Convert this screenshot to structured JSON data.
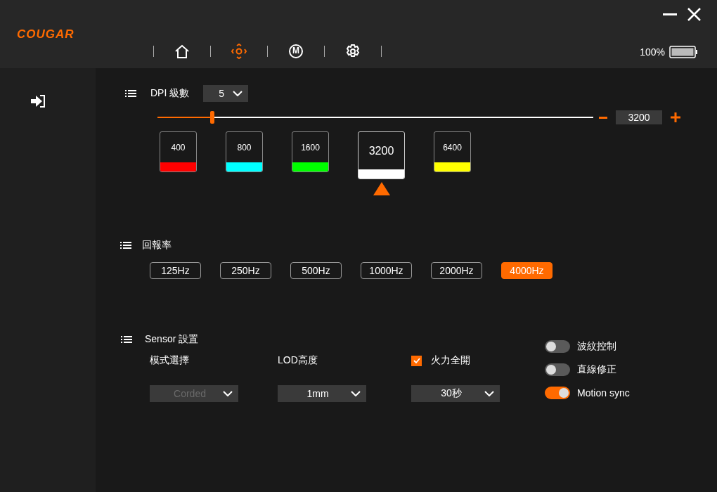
{
  "header": {
    "logo": "COUGAR",
    "nav": [
      {
        "kind": "home",
        "selected": false
      },
      {
        "kind": "dpi",
        "selected": true
      },
      {
        "kind": "macro",
        "label": "M",
        "selected": false
      },
      {
        "kind": "settings",
        "selected": false
      }
    ],
    "battery": "100%"
  },
  "dpi": {
    "title": "DPI 級數",
    "stage_count": "5",
    "level": 0.125,
    "value": "3200",
    "stages": [
      {
        "value": "400",
        "color": "#ff0000",
        "selected": false
      },
      {
        "value": "800",
        "color": "#00ffff",
        "selected": false
      },
      {
        "value": "1600",
        "color": "#00ff00",
        "selected": false
      },
      {
        "value": "3200",
        "color": "#ffffff",
        "selected": true
      },
      {
        "value": "6400",
        "color": "#ffff00",
        "selected": false
      }
    ]
  },
  "report_rate": {
    "title": "回報率",
    "options": [
      {
        "label": "125Hz",
        "selected": false
      },
      {
        "label": "250Hz",
        "selected": false
      },
      {
        "label": "500Hz",
        "selected": false
      },
      {
        "label": "1000Hz",
        "selected": false
      },
      {
        "label": "2000Hz",
        "selected": false
      },
      {
        "label": "4000Hz",
        "selected": true
      }
    ]
  },
  "sensor": {
    "title": "Sensor 設置",
    "mode": {
      "label": "模式選擇",
      "value": "Corded",
      "disabled": true
    },
    "lod": {
      "label": "LOD高度",
      "value": "1mm",
      "disabled": false
    },
    "full_fire": {
      "label": "火力全開",
      "checked": true,
      "value": "30秒",
      "disabled": false
    },
    "toggles": [
      {
        "label": "波紋控制",
        "on": false
      },
      {
        "label": "直線修正",
        "on": false
      },
      {
        "label": "Motion sync",
        "on": true
      }
    ]
  }
}
